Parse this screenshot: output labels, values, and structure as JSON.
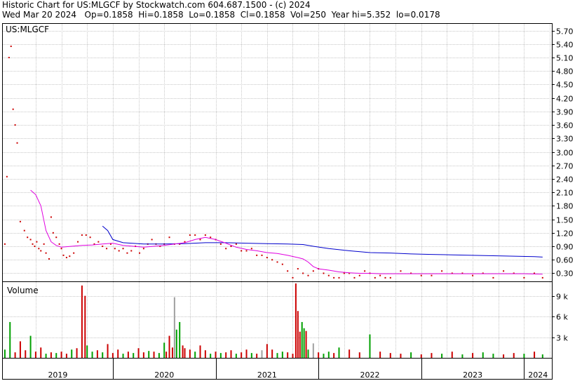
{
  "header": {
    "line1": "Historic Chart for US:MLGCF by Stockwatch.com 604.687.1500 - (c) 2024",
    "line2": "Wed Mar 20 2024   Op=0.1858  Hi=0.1858  Lo=0.1858  Cl=0.1858  Vol=250  Year hi=5.352  lo=0.0178"
  },
  "colors": {
    "up": "#00a000",
    "down": "#cc0000",
    "neutral": "#a0a0a0",
    "ma_short": "#e000e0",
    "ma_long": "#0000cc",
    "grid": "#c8c8c8",
    "frame": "#000000"
  },
  "chart_data": [
    {
      "type": "line",
      "title": "US:MLGCF",
      "y_scale": "linear",
      "ylim": [
        0.12,
        5.85
      ],
      "y_ticks": [
        "5.70",
        "5.40",
        "5.10",
        "4.80",
        "4.50",
        "4.20",
        "3.90",
        "3.60",
        "3.30",
        "3.00",
        "2.70",
        "2.40",
        "2.10",
        "1.80",
        "1.50",
        "1.20",
        "0.90",
        "0.60",
        "0.30"
      ],
      "x_ticks": [
        "2019",
        "2020",
        "2021",
        "2022",
        "2023",
        "2024"
      ],
      "grid": true,
      "series": [
        {
          "role": "price_ticks",
          "x": [
            2018.95,
            2018.97,
            2018.99,
            2019.01,
            2019.03,
            2019.05,
            2019.07,
            2019.1,
            2019.14,
            2019.17,
            2019.2,
            2019.22,
            2019.24,
            2019.26,
            2019.28,
            2019.3,
            2019.33,
            2019.35,
            2019.38,
            2019.4,
            2019.42,
            2019.45,
            2019.48,
            2019.5,
            2019.52,
            2019.55,
            2019.58,
            2019.62,
            2019.66,
            2019.7,
            2019.74,
            2019.78,
            2019.82,
            2019.86,
            2019.9,
            2019.94,
            2019.98,
            2020.02,
            2020.06,
            2020.1,
            2020.14,
            2020.18,
            2020.22,
            2020.26,
            2020.3,
            2020.34,
            2020.38,
            2020.42,
            2020.46,
            2020.5,
            2020.55,
            2020.6,
            2020.65,
            2020.7,
            2020.75,
            2020.8,
            2020.85,
            2020.9,
            2020.95,
            2021.0,
            2021.05,
            2021.1,
            2021.15,
            2021.2,
            2021.25,
            2021.3,
            2021.35,
            2021.4,
            2021.45,
            2021.5,
            2021.55,
            2021.6,
            2021.65,
            2021.7,
            2021.75,
            2021.8,
            2021.85,
            2021.9,
            2021.95,
            2022.0,
            2022.05,
            2022.1,
            2022.15,
            2022.2,
            2022.25,
            2022.3,
            2022.35,
            2022.4,
            2022.45,
            2022.5,
            2022.55,
            2022.6,
            2022.65,
            2022.7,
            2022.8,
            2022.9,
            2023.0,
            2023.1,
            2023.2,
            2023.3,
            2023.4,
            2023.5,
            2023.6,
            2023.7,
            2023.8,
            2023.9,
            2024.0,
            2024.1,
            2024.18
          ],
          "y": [
            0.95,
            2.45,
            5.1,
            5.35,
            3.95,
            3.6,
            3.2,
            1.45,
            1.25,
            1.1,
            1.05,
            0.95,
            0.9,
            1.0,
            0.85,
            0.8,
            0.95,
            0.75,
            0.62,
            1.55,
            1.2,
            1.1,
            0.95,
            0.85,
            0.7,
            0.65,
            0.68,
            0.75,
            1.0,
            1.15,
            1.15,
            1.1,
            0.95,
            1.0,
            0.9,
            0.85,
            0.95,
            0.85,
            0.8,
            0.85,
            0.75,
            0.8,
            0.9,
            0.75,
            0.85,
            0.95,
            1.05,
            0.95,
            0.9,
            0.95,
            1.1,
            0.95,
            0.95,
            1.0,
            1.15,
            1.15,
            1.05,
            1.15,
            1.1,
            1.05,
            0.95,
            0.85,
            0.9,
            0.95,
            0.8,
            0.8,
            0.85,
            0.7,
            0.7,
            0.65,
            0.6,
            0.55,
            0.5,
            0.35,
            0.2,
            0.4,
            0.3,
            0.25,
            0.35,
            0.4,
            0.3,
            0.25,
            0.2,
            0.2,
            0.3,
            0.3,
            0.2,
            0.25,
            0.35,
            0.3,
            0.2,
            0.25,
            0.2,
            0.2,
            0.35,
            0.3,
            0.25,
            0.25,
            0.35,
            0.3,
            0.3,
            0.25,
            0.3,
            0.2,
            0.35,
            0.3,
            0.2,
            0.3,
            0.2
          ]
        },
        {
          "role": "ma_short",
          "x": [
            2019.2,
            2019.25,
            2019.3,
            2019.35,
            2019.4,
            2019.45,
            2019.5,
            2019.6,
            2019.7,
            2019.8,
            2019.9,
            2020.0,
            2020.1,
            2020.2,
            2020.3,
            2020.4,
            2020.5,
            2020.6,
            2020.7,
            2020.8,
            2020.9,
            2021.0,
            2021.1,
            2021.2,
            2021.3,
            2021.4,
            2021.5,
            2021.6,
            2021.7,
            2021.8,
            2021.85,
            2021.9,
            2021.95,
            2022.0,
            2022.1,
            2022.2,
            2022.3,
            2022.4,
            2022.5,
            2022.6,
            2022.7,
            2022.8,
            2023.0,
            2023.2,
            2023.4,
            2023.6,
            2023.8,
            2024.0,
            2024.18
          ],
          "y": [
            2.15,
            2.05,
            1.8,
            1.25,
            1.0,
            0.92,
            0.88,
            0.9,
            0.92,
            0.93,
            0.95,
            0.97,
            0.92,
            0.9,
            0.88,
            0.9,
            0.92,
            0.95,
            0.98,
            1.05,
            1.1,
            1.05,
            0.97,
            0.88,
            0.83,
            0.8,
            0.76,
            0.74,
            0.7,
            0.65,
            0.62,
            0.55,
            0.45,
            0.4,
            0.37,
            0.33,
            0.31,
            0.3,
            0.3,
            0.29,
            0.29,
            0.29,
            0.29,
            0.29,
            0.29,
            0.29,
            0.29,
            0.29,
            0.28
          ]
        },
        {
          "role": "ma_long",
          "x": [
            2019.9,
            2019.95,
            2020.0,
            2020.1,
            2020.3,
            2020.5,
            2020.7,
            2020.9,
            2021.1,
            2021.3,
            2021.5,
            2021.7,
            2021.85,
            2021.95,
            2022.1,
            2022.3,
            2022.5,
            2022.7,
            2022.9,
            2023.1,
            2023.3,
            2023.5,
            2023.7,
            2023.9,
            2024.1,
            2024.18
          ],
          "y": [
            1.35,
            1.25,
            1.05,
            0.98,
            0.95,
            0.95,
            0.96,
            0.98,
            0.98,
            0.97,
            0.96,
            0.95,
            0.94,
            0.9,
            0.85,
            0.8,
            0.76,
            0.75,
            0.73,
            0.72,
            0.71,
            0.7,
            0.69,
            0.68,
            0.67,
            0.66
          ]
        }
      ]
    },
    {
      "type": "bar",
      "title": "Volume",
      "ylim": [
        0,
        11000
      ],
      "y_ticks": [
        "9 k",
        "6 k",
        "3 k"
      ],
      "y_tick_values": [
        9000,
        6000,
        3000
      ],
      "x": [
        2018.95,
        2019.0,
        2019.05,
        2019.1,
        2019.15,
        2019.2,
        2019.25,
        2019.3,
        2019.35,
        2019.4,
        2019.45,
        2019.5,
        2019.55,
        2019.6,
        2019.65,
        2019.7,
        2019.73,
        2019.75,
        2019.8,
        2019.85,
        2019.9,
        2019.95,
        2020.0,
        2020.05,
        2020.1,
        2020.15,
        2020.2,
        2020.25,
        2020.3,
        2020.35,
        2020.4,
        2020.45,
        2020.5,
        2020.52,
        2020.55,
        2020.58,
        2020.6,
        2020.62,
        2020.65,
        2020.68,
        2020.7,
        2020.75,
        2020.8,
        2020.85,
        2020.9,
        2020.95,
        2021.0,
        2021.05,
        2021.1,
        2021.15,
        2021.2,
        2021.25,
        2021.3,
        2021.35,
        2021.4,
        2021.45,
        2021.5,
        2021.55,
        2021.6,
        2021.65,
        2021.7,
        2021.75,
        2021.78,
        2021.8,
        2021.82,
        2021.84,
        2021.86,
        2021.88,
        2021.9,
        2021.95,
        2022.0,
        2022.05,
        2022.1,
        2022.15,
        2022.2,
        2022.3,
        2022.4,
        2022.5,
        2022.6,
        2022.7,
        2022.8,
        2022.9,
        2023.0,
        2023.1,
        2023.2,
        2023.3,
        2023.4,
        2023.5,
        2023.6,
        2023.7,
        2023.8,
        2023.9,
        2024.0,
        2024.1,
        2024.18
      ],
      "values": [
        1200,
        5200,
        800,
        2400,
        1100,
        3200,
        900,
        1500,
        600,
        800,
        700,
        900,
        600,
        1200,
        1400,
        10500,
        9000,
        1800,
        900,
        1100,
        800,
        2000,
        700,
        1200,
        600,
        900,
        700,
        1400,
        800,
        1000,
        900,
        700,
        2200,
        900,
        3200,
        1500,
        8800,
        4100,
        5200,
        1800,
        1400,
        1200,
        900,
        1800,
        1100,
        600,
        900,
        700,
        800,
        1100,
        600,
        800,
        1200,
        700,
        600,
        1100,
        2000,
        1200,
        700,
        900,
        800,
        600,
        10800,
        6800,
        3800,
        5200,
        4300,
        3900,
        1200,
        2100,
        800,
        600,
        900,
        700,
        1500,
        1200,
        800,
        3400,
        900,
        700,
        600,
        800,
        500,
        700,
        600,
        900,
        500,
        700,
        800,
        600,
        500,
        700,
        600,
        900,
        500
      ],
      "color_class": [
        "up",
        "up",
        "down",
        "down",
        "down",
        "up",
        "down",
        "down",
        "up",
        "down",
        "up",
        "down",
        "down",
        "up",
        "down",
        "down",
        "down",
        "up",
        "up",
        "down",
        "up",
        "down",
        "down",
        "down",
        "up",
        "down",
        "up",
        "down",
        "down",
        "up",
        "down",
        "up",
        "up",
        "down",
        "down",
        "down",
        "neutral",
        "up",
        "up",
        "down",
        "down",
        "down",
        "up",
        "down",
        "down",
        "up",
        "down",
        "up",
        "down",
        "down",
        "up",
        "down",
        "down",
        "up",
        "down",
        "neutral",
        "down",
        "down",
        "up",
        "up",
        "down",
        "down",
        "down",
        "down",
        "down",
        "up",
        "up",
        "down",
        "up",
        "neutral",
        "down",
        "up",
        "up",
        "down",
        "up",
        "down",
        "down",
        "up",
        "down",
        "down",
        "down",
        "up",
        "down",
        "down",
        "up",
        "down",
        "up",
        "down",
        "up",
        "up",
        "down",
        "down",
        "up",
        "down",
        "up"
      ]
    }
  ]
}
